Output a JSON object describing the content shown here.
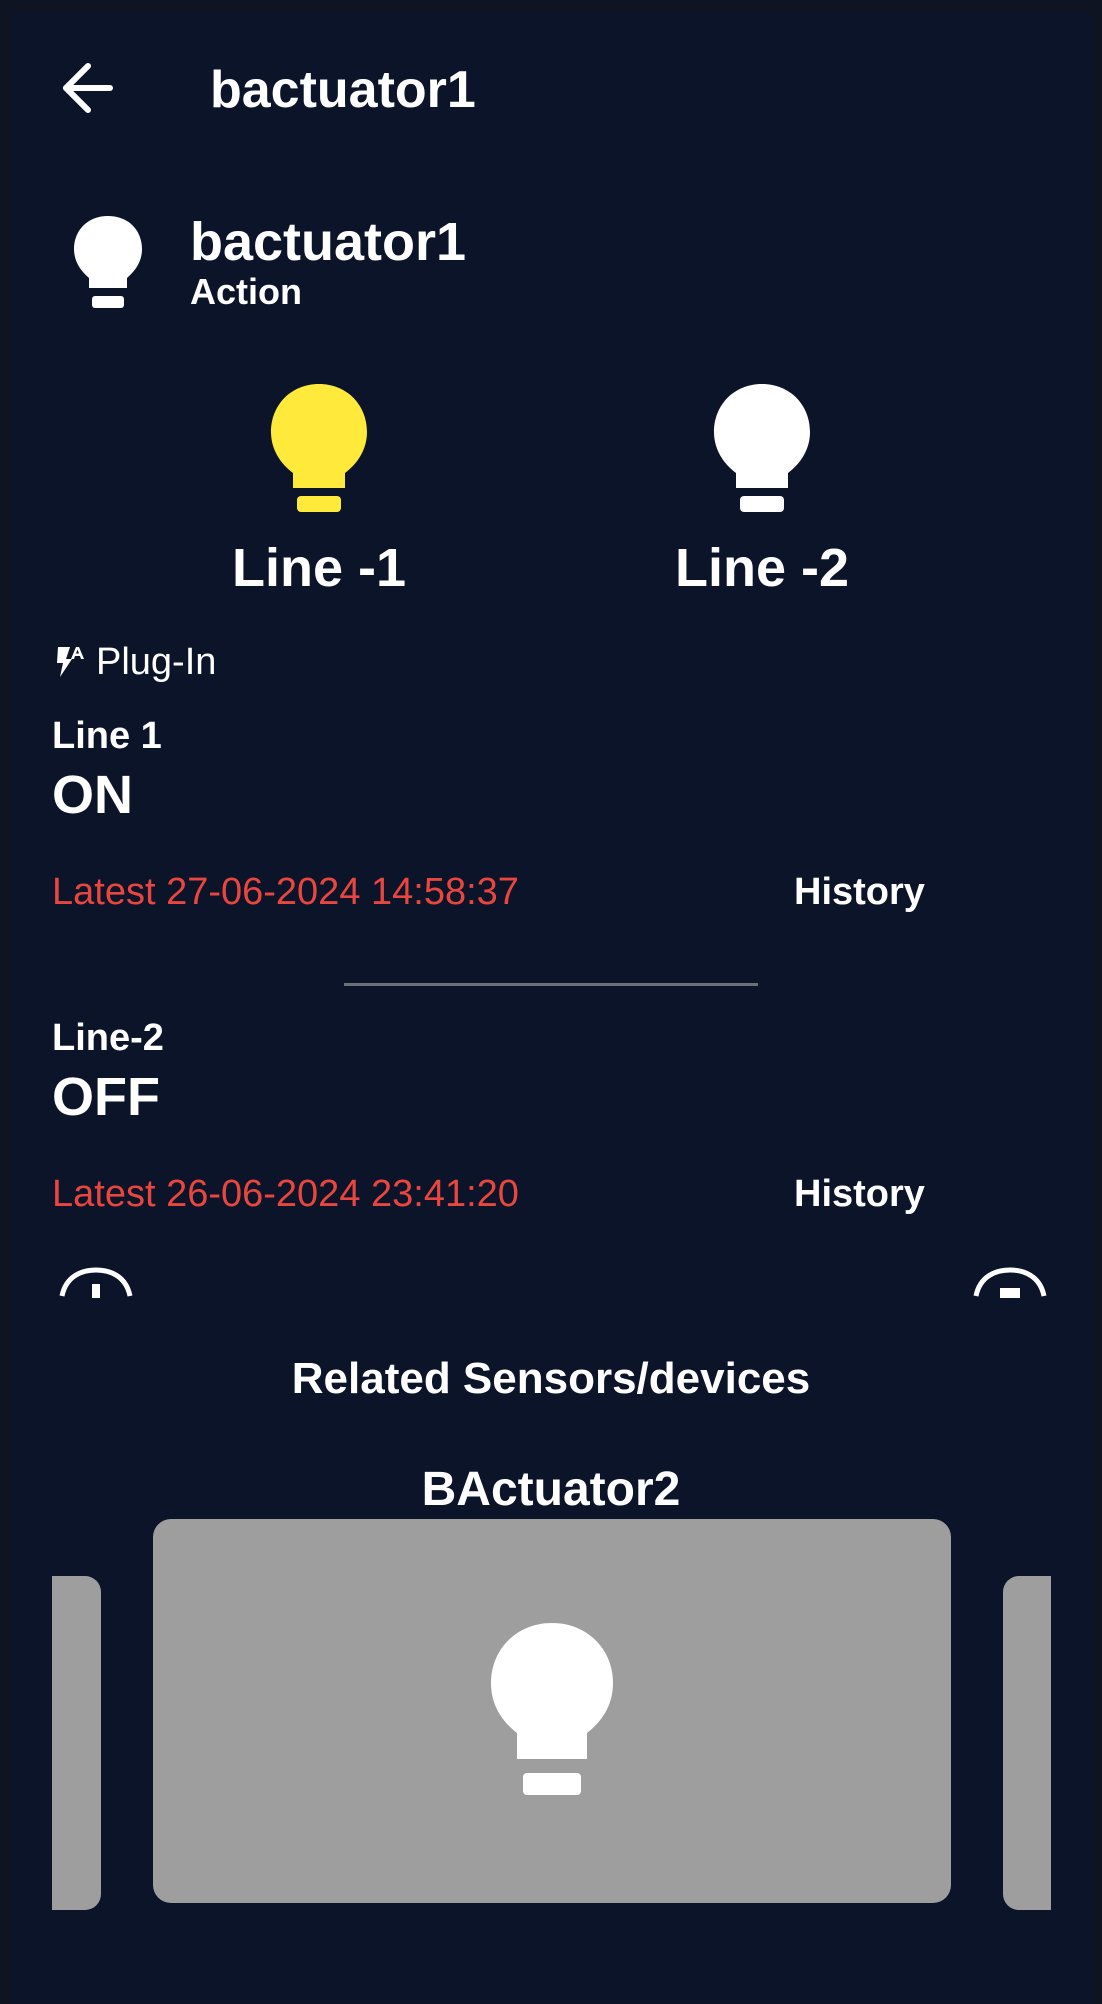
{
  "header": {
    "title": "bactuator1",
    "back_icon": "arrow-left-icon"
  },
  "device": {
    "name": "bactuator1",
    "subtitle": "Action",
    "icon": "lightbulb-icon"
  },
  "lines": [
    {
      "label": "Line -1",
      "state": "ON",
      "bulb_color": "#ffe93b"
    },
    {
      "label": "Line -2",
      "state": "OFF",
      "bulb_color": "#ffffff"
    }
  ],
  "plugin": {
    "icon": "power-plug-icon",
    "label": "Plug-In"
  },
  "status": [
    {
      "title": "Line 1",
      "value": "ON",
      "latest": "Latest 27-06-2024 14:58:37",
      "history_label": "History"
    },
    {
      "title": "Line-2",
      "value": "OFF",
      "latest": "Latest 26-06-2024 23:41:20",
      "history_label": "History"
    }
  ],
  "related": {
    "title": "Related Sensors/devices",
    "current_item": "BActuator2",
    "card_icon": "lightbulb-icon"
  },
  "colors": {
    "background": "#0b1429",
    "accent_yellow": "#ffe93b",
    "latest_red": "#e8463e",
    "card_gray": "#9e9e9e"
  }
}
